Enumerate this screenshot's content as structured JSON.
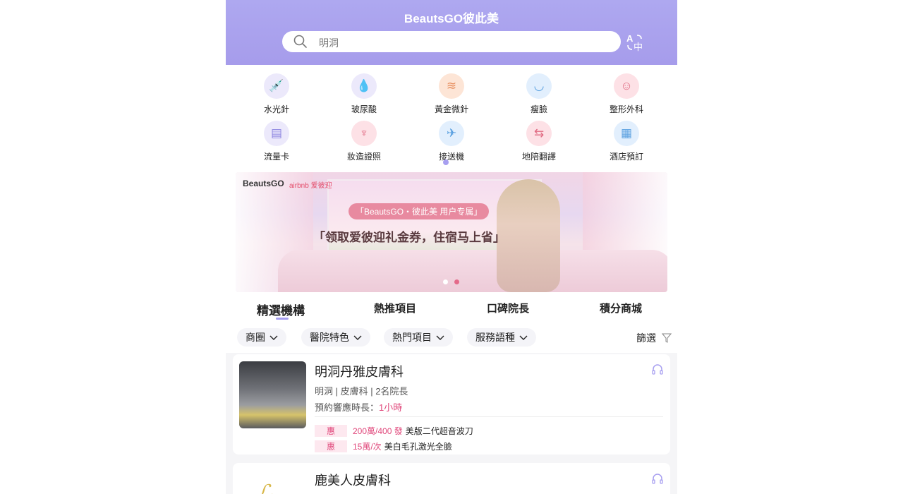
{
  "header": {
    "title": "BeautsGO彼此美",
    "search_value": "明洞",
    "icons": {
      "search": "search-icon",
      "translate": "translate-icon"
    },
    "bg_color": "#a8a0ee"
  },
  "categories": [
    {
      "label": "水光針",
      "icon": "syringe-icon",
      "bg": "#ece9fb"
    },
    {
      "label": "玻尿酸",
      "icon": "droplet-icon",
      "bg": "#ece9fb"
    },
    {
      "label": "黃金微針",
      "icon": "microneedle-icon",
      "bg": "#fde5d6"
    },
    {
      "label": "瘦臉",
      "icon": "face-slim-icon",
      "bg": "#e2effd"
    },
    {
      "label": "整形外科",
      "icon": "face-surgery-icon",
      "bg": "#fde1e6"
    },
    {
      "label": "流量卡",
      "icon": "sim-card-icon",
      "bg": "#ece9fb"
    },
    {
      "label": "妝造證照",
      "icon": "makeup-brush-icon",
      "bg": "#fde1e6"
    },
    {
      "label": "接送機",
      "icon": "airplane-icon",
      "bg": "#e2effd"
    },
    {
      "label": "地陪翻譯",
      "icon": "translate-card-icon",
      "bg": "#fde1e6"
    },
    {
      "label": "酒店預訂",
      "icon": "hotel-doc-icon",
      "bg": "#e2effd"
    }
  ],
  "banner": {
    "brand": "BeautsGO",
    "partner": "airbnb 爱彼迎",
    "tag": "「BeautsGO・彼此美 用户专属」",
    "slogan": "「领取爱彼迎礼金券，住宿马上省」"
  },
  "tabs": [
    "精選機構",
    "熱推項目",
    "口碑院長",
    "積分商城"
  ],
  "filters": [
    "商圈",
    "醫院特色",
    "熱門項目",
    "服務語種"
  ],
  "filter_right": "篩選",
  "clinics": [
    {
      "name": "明洞丹雅皮膚科",
      "meta": "明洞 |  皮膚科 |  2名院長",
      "response_label": "預約響應時長：",
      "response_value": "1小時",
      "deals": [
        {
          "tag": "惠",
          "price": "200萬/400 發",
          "desc": "美版二代超音波刀"
        },
        {
          "tag": "惠",
          "price": "15萬/次",
          "desc": "美白毛孔激光全臉"
        }
      ]
    },
    {
      "name": "鹿美人皮膚科"
    }
  ],
  "colors": {
    "accent": "#a79ff0",
    "price": "#e0467a"
  }
}
